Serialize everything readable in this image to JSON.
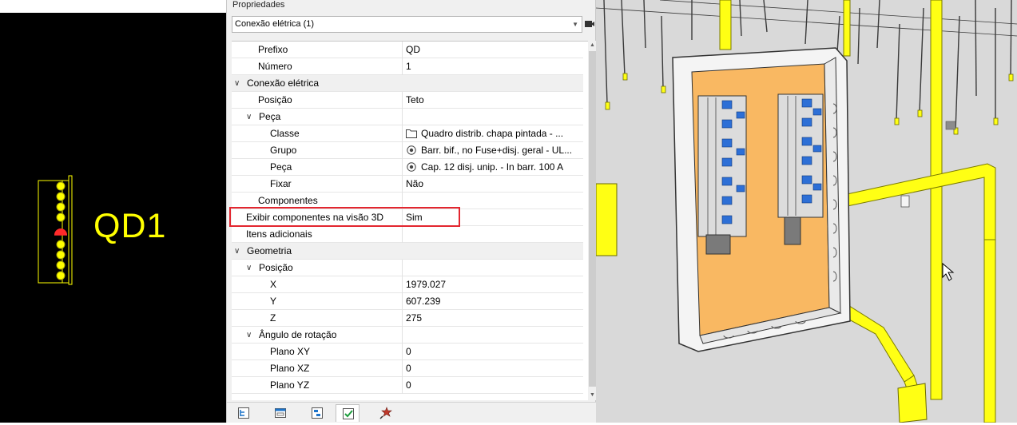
{
  "cad": {
    "label": "QD1",
    "colors": {
      "background": "#000000",
      "symbol": "#ffff00",
      "marker": "#ff2a2a"
    }
  },
  "properties": {
    "title": "Propriedades",
    "selector_value": "Conexão elétrica (1)",
    "rows": [
      {
        "name": "Prefixo",
        "value": "QD",
        "level": 1,
        "type": "prop"
      },
      {
        "name": "Número",
        "value": "1",
        "level": 1,
        "type": "prop"
      },
      {
        "name": "Conexão elétrica",
        "value": "",
        "level": 0,
        "type": "category"
      },
      {
        "name": "Posição",
        "value": "Teto",
        "level": 1,
        "type": "prop"
      },
      {
        "name": "Peça",
        "value": "",
        "level": 1,
        "type": "subcategory"
      },
      {
        "name": "Classe",
        "value": "Quadro distrib. chapa pintada - ...",
        "level": 2,
        "type": "prop",
        "icon": "folder-icon"
      },
      {
        "name": "Grupo",
        "value": "Barr. bif., no Fuse+disj. geral - UL...",
        "level": 2,
        "type": "prop",
        "icon": "target-icon"
      },
      {
        "name": "Peça",
        "value": "Cap. 12 disj. unip. - In barr. 100 A",
        "level": 2,
        "type": "prop",
        "icon": "target-icon"
      },
      {
        "name": "Fixar",
        "value": "Não",
        "level": 2,
        "type": "prop"
      },
      {
        "name": "Componentes",
        "value": "",
        "level": 1,
        "type": "prop"
      },
      {
        "name": "Exibir componentes na visão 3D",
        "value": "Sim",
        "level": 0,
        "type": "prop"
      },
      {
        "name": "Itens adicionais",
        "value": "",
        "level": 0,
        "type": "prop"
      },
      {
        "name": "Geometria",
        "value": "",
        "level": 0,
        "type": "category"
      },
      {
        "name": "Posição",
        "value": "",
        "level": 1,
        "type": "subcategory"
      },
      {
        "name": "X",
        "value": "1979.027",
        "level": 2,
        "type": "prop"
      },
      {
        "name": "Y",
        "value": "607.239",
        "level": 2,
        "type": "prop"
      },
      {
        "name": "Z",
        "value": "275",
        "level": 2,
        "type": "prop"
      },
      {
        "name": "Ângulo de rotação",
        "value": "",
        "level": 1,
        "type": "subcategory"
      },
      {
        "name": "Plano XY",
        "value": "0",
        "level": 2,
        "type": "prop"
      },
      {
        "name": "Plano XZ",
        "value": "0",
        "level": 2,
        "type": "prop"
      },
      {
        "name": "Plano YZ",
        "value": "0",
        "level": 2,
        "type": "prop"
      }
    ],
    "highlight_color": "#e3262f",
    "toolbar_icons": [
      "tree-view-icon",
      "window-view-icon",
      "list-view-icon",
      "properties-check-icon",
      "pin-star-icon"
    ],
    "active_tool": "properties-check-icon"
  },
  "view3d": {
    "colors": {
      "floor": "#d9d9d9",
      "conduit": "#ffff14",
      "panel_back": "#f9b862",
      "enclosure": "#f4f4f4",
      "breaker": "#2d6fd6"
    }
  }
}
